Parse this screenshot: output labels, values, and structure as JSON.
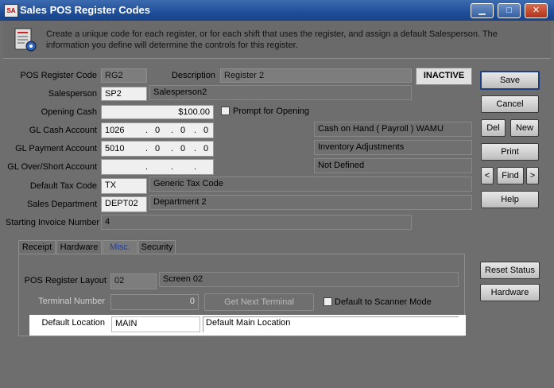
{
  "window": {
    "icon": "SA",
    "title": "Sales POS Register Codes",
    "minimize_icon": "minimize-icon",
    "maximize_icon": "maximize-icon",
    "close_icon": "close-icon"
  },
  "header": {
    "icon": "info-document-icon",
    "text": "Create a unique code for each register, or for each shift that uses the register, and assign a default Salesperson. The information you define will determine the controls for this register."
  },
  "status": "INACTIVE",
  "form": {
    "pos_register_code": {
      "label": "POS Register Code",
      "value": "RG2"
    },
    "description": {
      "label": "Description",
      "value": "Register 2"
    },
    "salesperson": {
      "label": "Salesperson",
      "value": "SP2",
      "name": "Salesperson2"
    },
    "opening_cash": {
      "label": "Opening Cash",
      "value": "$100.00"
    },
    "prompt_for_opening": {
      "label": "Prompt for Opening",
      "checked": false
    },
    "gl_cash_account": {
      "label": "GL Cash Account",
      "parts": [
        "1026",
        ".",
        "0",
        ".",
        "0",
        ".",
        "0"
      ],
      "description": "Cash on Hand ( Payroll ) WAMU"
    },
    "gl_payment_account": {
      "label": "GL Payment Account",
      "parts": [
        "5010",
        ".",
        "0",
        ".",
        "0",
        ".",
        "0"
      ],
      "description": "Inventory Adjustments"
    },
    "gl_over_short_account": {
      "label": "GL Over/Short Account",
      "parts": [
        "",
        ".",
        "",
        ".",
        "",
        ".",
        ""
      ],
      "description": "Not Defined"
    },
    "default_tax_code": {
      "label": "Default Tax Code",
      "value": "TX",
      "description": "Generic Tax Code"
    },
    "sales_department": {
      "label": "Sales Department",
      "value": "DEPT02",
      "description": "Department 2"
    },
    "starting_invoice_number": {
      "label": "Starting Invoice Number",
      "value": "4"
    }
  },
  "buttons": {
    "save": "Save",
    "cancel": "Cancel",
    "del": "Del",
    "new": "New",
    "print": "Print",
    "prev": "<",
    "find": "Find",
    "next": ">",
    "help": "Help",
    "reset_status": "Reset Status",
    "hardware": "Hardware"
  },
  "tabs": {
    "items": [
      "Receipt",
      "Hardware",
      "Misc.",
      "Security"
    ],
    "selected": "Misc."
  },
  "misc": {
    "pos_register_layout": {
      "label": "POS Register Layout",
      "value": "02",
      "description": "Screen 02"
    },
    "terminal_number": {
      "label": "Terminal Number",
      "value": "0"
    },
    "get_next_terminal": "Get Next Terminal",
    "default_to_scanner_mode": {
      "label": "Default to Scanner Mode",
      "checked": false
    },
    "default_location": {
      "label": "Default Location",
      "value": "MAIN",
      "description": "Default Main Location"
    }
  }
}
